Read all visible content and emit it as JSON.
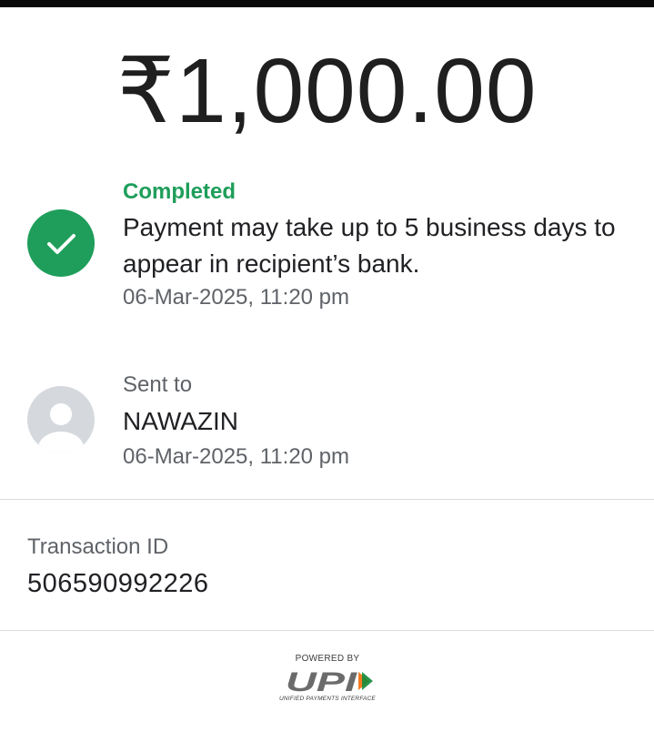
{
  "payment": {
    "amount": "₹1,000.00"
  },
  "status": {
    "icon": "check-circle-icon",
    "label": "Completed",
    "description": "Payment may take up to 5 business days to appear in recipient’s bank.",
    "timestamp": "06-Mar-2025, 11:20 pm",
    "color": "#1e9e5a"
  },
  "recipient": {
    "icon": "person-avatar-icon",
    "label": "Sent to",
    "name": "NAWAZIN",
    "timestamp": "06-Mar-2025, 11:20 pm"
  },
  "transaction": {
    "label": "Transaction ID",
    "id": "506590992226"
  },
  "footer": {
    "powered_by": "POWERED BY",
    "logo_text": "UPI",
    "tagline": "UNIFIED PAYMENTS INTERFACE"
  }
}
